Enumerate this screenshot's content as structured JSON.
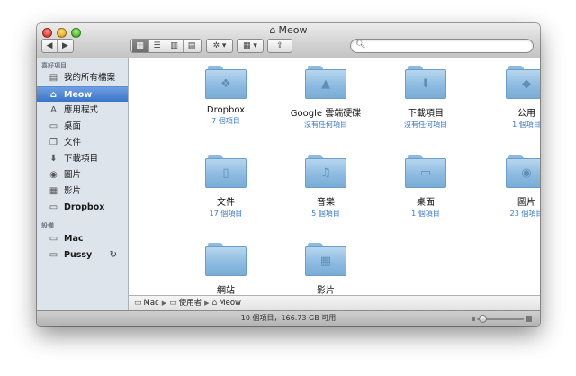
{
  "window": {
    "title": "Meow"
  },
  "toolbar": {
    "back_label": "◀",
    "forward_label": "▶",
    "view_icons": "▦",
    "view_list": "☰",
    "view_columns": "▥",
    "view_coverflow": "▤",
    "action_label": "✲ ▾",
    "arrange_label": "▦ ▾",
    "share_label": "⇪",
    "search_placeholder": ""
  },
  "sidebar": {
    "favorites_heading": "喜好項目",
    "items": [
      {
        "label": "我的所有檔案",
        "icon": "all-files-icon",
        "glyph": "▤"
      },
      {
        "label": "Meow",
        "icon": "home-icon",
        "glyph": "⌂"
      },
      {
        "label": "應用程式",
        "icon": "applications-icon",
        "glyph": "A"
      },
      {
        "label": "桌面",
        "icon": "desktop-icon",
        "glyph": "▭"
      },
      {
        "label": "文件",
        "icon": "documents-icon",
        "glyph": "❐"
      },
      {
        "label": "下載項目",
        "icon": "downloads-icon",
        "glyph": "⬇"
      },
      {
        "label": "圖片",
        "icon": "pictures-icon",
        "glyph": "◉"
      },
      {
        "label": "影片",
        "icon": "movies-icon",
        "glyph": "▦"
      },
      {
        "label": "Dropbox",
        "icon": "folder-icon",
        "glyph": "▭"
      }
    ],
    "devices_heading": "設備",
    "devices": [
      {
        "label": "Mac",
        "icon": "computer-icon",
        "glyph": "▭"
      },
      {
        "label": "Pussy",
        "icon": "disk-icon",
        "glyph": "▭",
        "eject": "↻"
      }
    ]
  },
  "items": [
    {
      "name": "Dropbox",
      "sub": "7 個項目",
      "icon": "dropbox-folder-icon",
      "emblem": "❖"
    },
    {
      "name": "Google 雲端硬碟",
      "sub": "沒有任何項目",
      "icon": "google-drive-folder-icon",
      "emblem": "▲"
    },
    {
      "name": "下載項目",
      "sub": "沒有任何項目",
      "icon": "downloads-folder-icon",
      "emblem": "⬇"
    },
    {
      "name": "公用",
      "sub": "1 個項目",
      "icon": "public-folder-icon",
      "emblem": "◆"
    },
    {
      "name": "文件",
      "sub": "17 個項目",
      "icon": "documents-folder-icon",
      "emblem": "▯"
    },
    {
      "name": "音樂",
      "sub": "5 個項目",
      "icon": "music-folder-icon",
      "emblem": "♫"
    },
    {
      "name": "桌面",
      "sub": "1 個項目",
      "icon": "desktop-folder-icon",
      "emblem": "▭"
    },
    {
      "name": "圖片",
      "sub": "23 個項目",
      "icon": "pictures-folder-icon",
      "emblem": "◉"
    },
    {
      "name": "網站",
      "sub": "",
      "icon": "sites-folder-icon",
      "emblem": ""
    },
    {
      "name": "影片",
      "sub": "",
      "icon": "movies-folder-icon",
      "emblem": "▦"
    }
  ],
  "pathbar": {
    "segments": [
      "Mac",
      "使用者",
      "Meow"
    ],
    "separator": "▶"
  },
  "status": {
    "text": "10 個項目，166.73 GB 可用",
    "icon_size_fraction": 0.12
  }
}
